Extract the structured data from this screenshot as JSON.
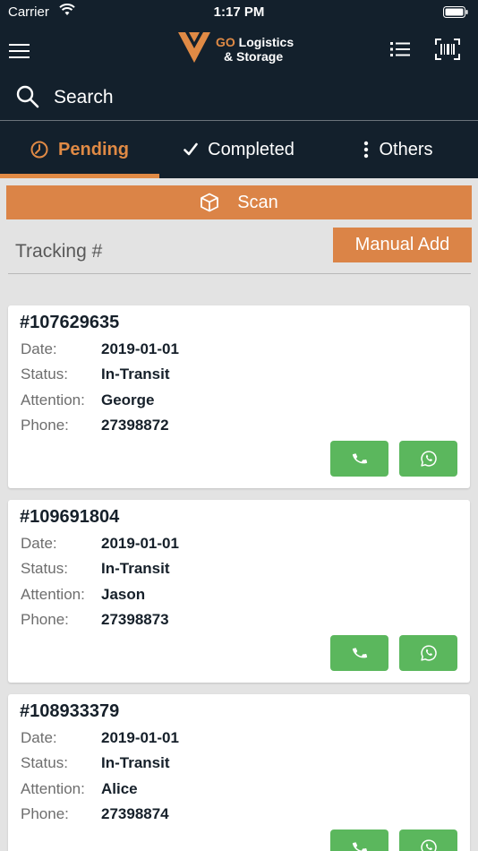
{
  "status_bar": {
    "carrier": "Carrier",
    "time": "1:17 PM"
  },
  "brand": {
    "go": "GO",
    "name": "Logistics",
    "sub": "& Storage",
    "accent": "#e08a45"
  },
  "search": {
    "placeholder": "Search"
  },
  "tabs": [
    {
      "label": "Pending",
      "icon": "clock-icon",
      "active": true
    },
    {
      "label": "Completed",
      "icon": "checkmark-icon",
      "active": false
    },
    {
      "label": "Others",
      "icon": "vertical-dots-icon",
      "active": false
    }
  ],
  "scan": {
    "label": "Scan",
    "icon": "box-icon"
  },
  "tracking": {
    "placeholder": "Tracking #",
    "manual_add": "Manual Add"
  },
  "field_labels": {
    "date": "Date:",
    "status": "Status:",
    "attention": "Attention:",
    "phone": "Phone:"
  },
  "shipments": [
    {
      "tracking": "#107629635",
      "date": "2019-01-01",
      "status": "In-Transit",
      "attention": "George",
      "phone": "27398872"
    },
    {
      "tracking": "#109691804",
      "date": "2019-01-01",
      "status": "In-Transit",
      "attention": "Jason",
      "phone": "27398873"
    },
    {
      "tracking": "#108933379",
      "date": "2019-01-01",
      "status": "In-Transit",
      "attention": "Alice",
      "phone": "27398874"
    }
  ],
  "colors": {
    "header_bg": "#13202c",
    "accent": "#db8447",
    "action_green": "#5bb75d",
    "page_bg": "#e3e3e3"
  }
}
